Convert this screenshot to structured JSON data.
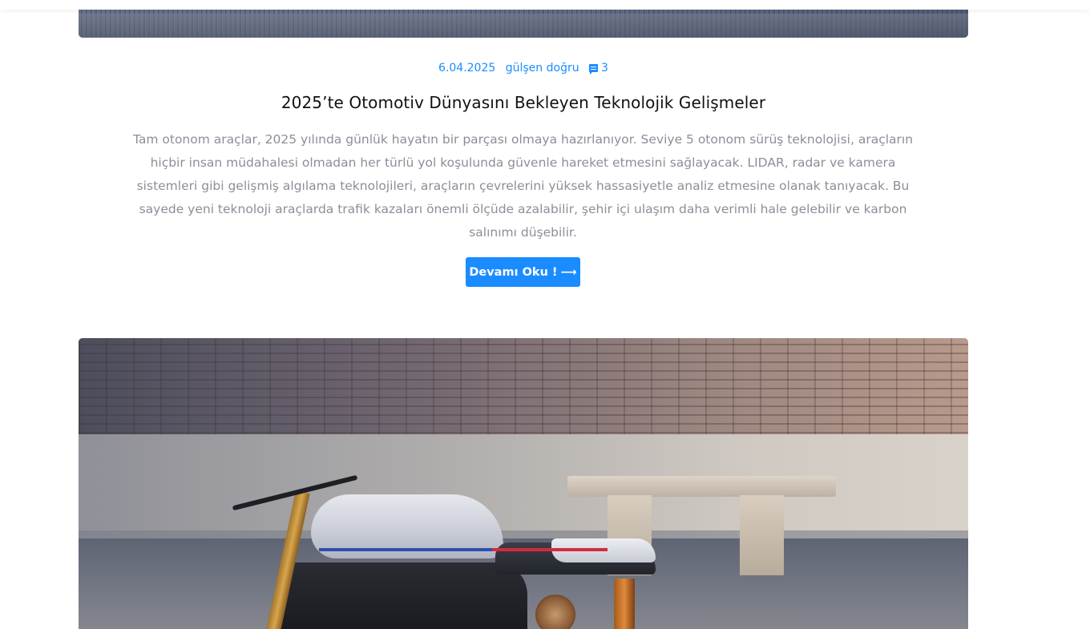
{
  "post": {
    "date": "6.04.2025",
    "author": "gülşen doğru",
    "comment_count": "3",
    "title": "2025’te Otomotiv Dünyasını Bekleyen Teknolojik Gelişmeler",
    "excerpt": "Tam otonom araçlar, 2025 yılında günlük hayatın bir parçası olmaya hazırlanıyor. Seviye 5 otonom sürüş teknolojisi, araçların hiçbir insan müdahalesi olmadan her türlü yol koşulunda güvenle hareket etmesini sağlayacak. LIDAR, radar ve kamera sistemleri gibi gelişmiş algılama teknolojileri, araçların çevrelerini yüksek hassasiyetle analiz etmesine olanak tanıyacak. Bu sayede yeni teknoloji araçlarda trafik kazaları önemli ölçüde azalabilir, şehir içi ulaşım daha verimli hale gelebilir ve karbon salınımı düşebilir.",
    "read_more_label": "Devamı Oku !",
    "read_more_icon": "arrow-right-icon"
  },
  "icons": {
    "comment": "comment-icon"
  },
  "colors": {
    "accent": "#1a8cff",
    "title": "#111111",
    "excerpt": "#8a8f98"
  }
}
